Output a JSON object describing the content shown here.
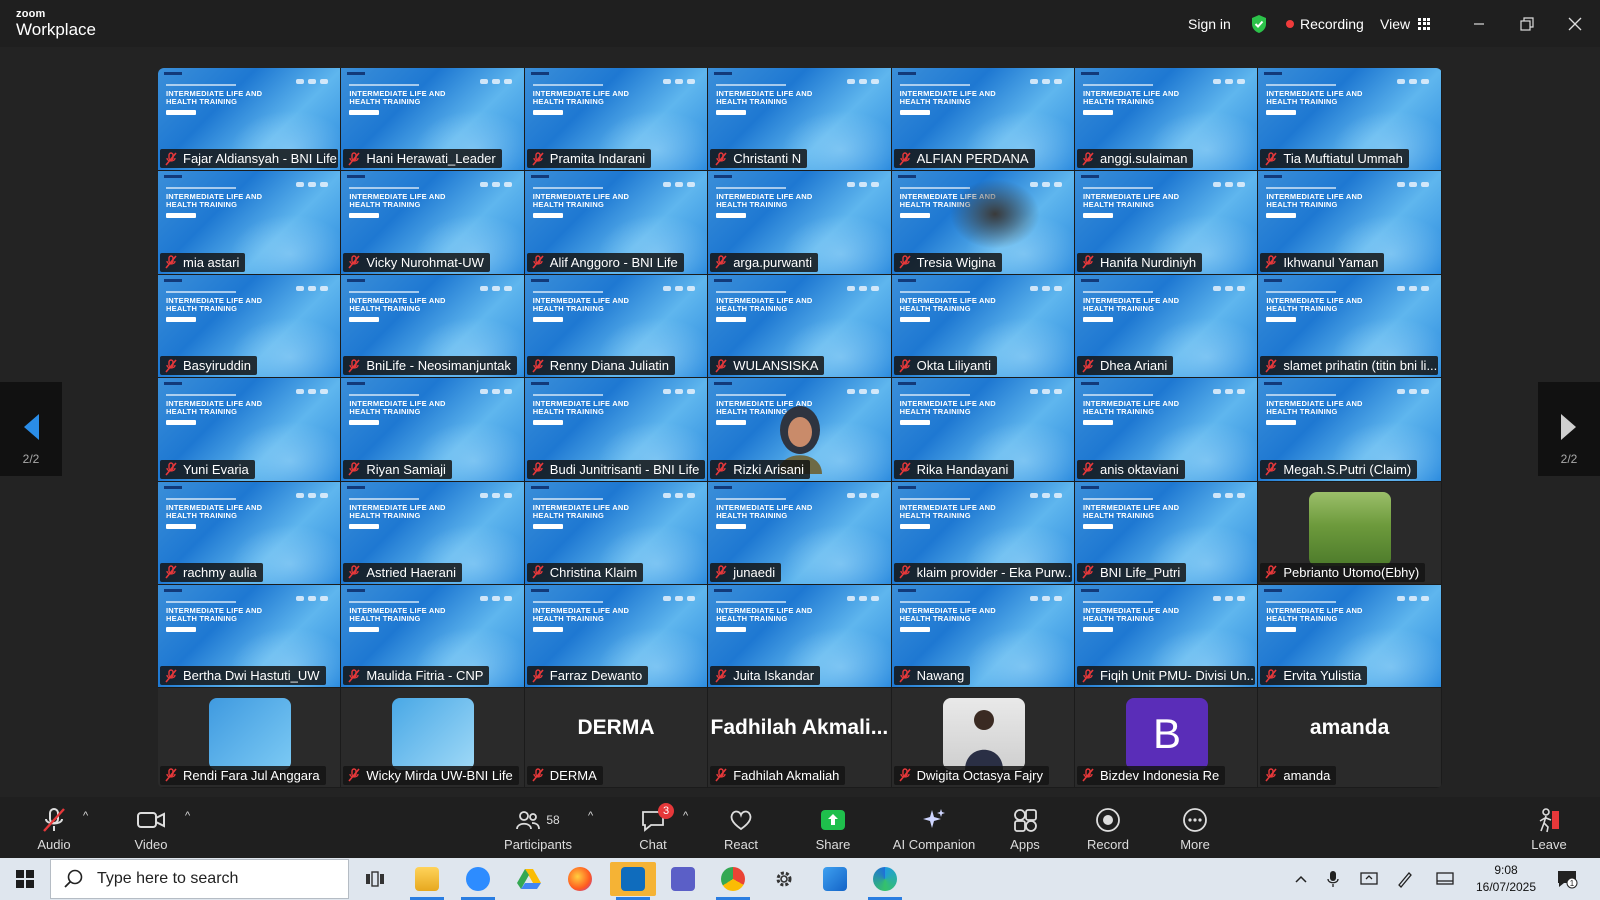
{
  "app": {
    "brand_top": "zoom",
    "brand_bottom": "Workplace"
  },
  "titlebar": {
    "sign_in": "Sign in",
    "recording": "Recording",
    "view": "View"
  },
  "pager": {
    "left_label": "2/2",
    "right_label": "2/2"
  },
  "slide": {
    "title": "INTERMEDIATE LIFE AND HEALTH TRAINING"
  },
  "participants_grid": [
    "Fajar Aldiansyah - BNI Life",
    "Hani Herawati_Leader",
    "Pramita Indarani",
    "Christanti N",
    "ALFIAN PERDANA",
    "anggi.sulaiman",
    "Tia Muftiatul Ummah",
    "mia astari",
    "Vicky Nurohmat-UW",
    "Alif Anggoro - BNI Life",
    "arga.purwanti",
    "Tresia Wigina",
    "Hanifa Nurdiniyh",
    "Ikhwanul Yaman",
    "Basyiruddin",
    "BniLife - Neosimanjuntak",
    "Renny Diana Juliatin",
    "WULANSISKA",
    "Okta Liliyanti",
    "Dhea Ariani",
    "slamet prihatin (titin bni li...",
    "Yuni Evaria",
    "Riyan Samiaji",
    "Budi Junitrisanti - BNI Life",
    "Rizki Arisani",
    "Rika Handayani",
    "anis oktaviani",
    "Megah.S.Putri (Claim)",
    "rachmy aulia",
    "Astried Haerani",
    "Christina Klaim",
    "junaedi",
    "klaim provider - Eka Purw...",
    "BNI Life_Putri",
    "Pebrianto Utomo(Ebhy)",
    "Bertha Dwi Hastuti_UW",
    "Maulida Fitria - CNP",
    "Farraz Dewanto",
    "Juita Iskandar",
    "Nawang",
    "Fiqih Unit PMU- Divisi Un...",
    "Ervita Yulistia"
  ],
  "bottom_row": [
    {
      "name": "Rendi Fara Jul Anggara",
      "display": ""
    },
    {
      "name": "Wicky Mirda UW-BNI Life",
      "display": ""
    },
    {
      "name": "DERMA",
      "display": "DERMA"
    },
    {
      "name": "Fadhilah Akmaliah",
      "display": "Fadhilah  Akmali..."
    },
    {
      "name": "Dwigita Octasya Fajry",
      "display": ""
    },
    {
      "name": "Bizdev Indonesia Re",
      "display": "B"
    },
    {
      "name": "amanda",
      "display": "amanda"
    }
  ],
  "toolbar": {
    "audio": "Audio",
    "video": "Video",
    "participants": "Participants",
    "participants_count": "58",
    "chat": "Chat",
    "chat_badge": "3",
    "react": "React",
    "share": "Share",
    "ai_companion": "AI Companion",
    "apps": "Apps",
    "record": "Record",
    "more": "More",
    "leave": "Leave"
  },
  "taskbar": {
    "search_placeholder": "Type here to search",
    "time": "9:08",
    "date": "16/07/2025"
  },
  "colors": {
    "share_green": "#1fbf4c",
    "recording_red": "#ef3b3b",
    "avatar_purple": "#5a2db8",
    "chat_badge_red": "#e6383a"
  }
}
